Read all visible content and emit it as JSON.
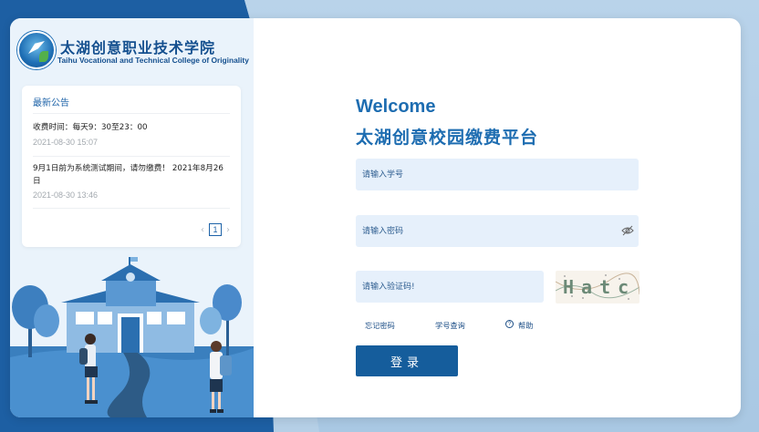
{
  "brand": {
    "school_cn": "太湖创意职业技术学院",
    "school_en": "Taihu Vocational and Technical College of Originality",
    "primary_color": "#1e6db1",
    "dark_color": "#155d9c",
    "logo_icon": "school-emblem"
  },
  "notice": {
    "title": "最新公告",
    "items": [
      {
        "text": "收费时间：每天9：30至23：00",
        "date": "2021-08-30 15:07"
      },
      {
        "text": "9月1日前为系统测试期间，请勿缴费！ 2021年8月26日",
        "date": "2021-08-30 13:46"
      }
    ],
    "pager": {
      "prev": "‹",
      "current": "1",
      "next": "›"
    }
  },
  "login": {
    "welcome": "Welcome",
    "platform": "太湖创意校园缴费平台",
    "id_placeholder": "请输入学号",
    "password_placeholder": "请输入密码",
    "captcha_placeholder": "请输入验证码!",
    "captcha_text": "Hatc",
    "forgot_password": "忘记密码",
    "id_lookup": "学号查询",
    "help": "帮助",
    "help_icon": "?",
    "submit": "登录"
  }
}
